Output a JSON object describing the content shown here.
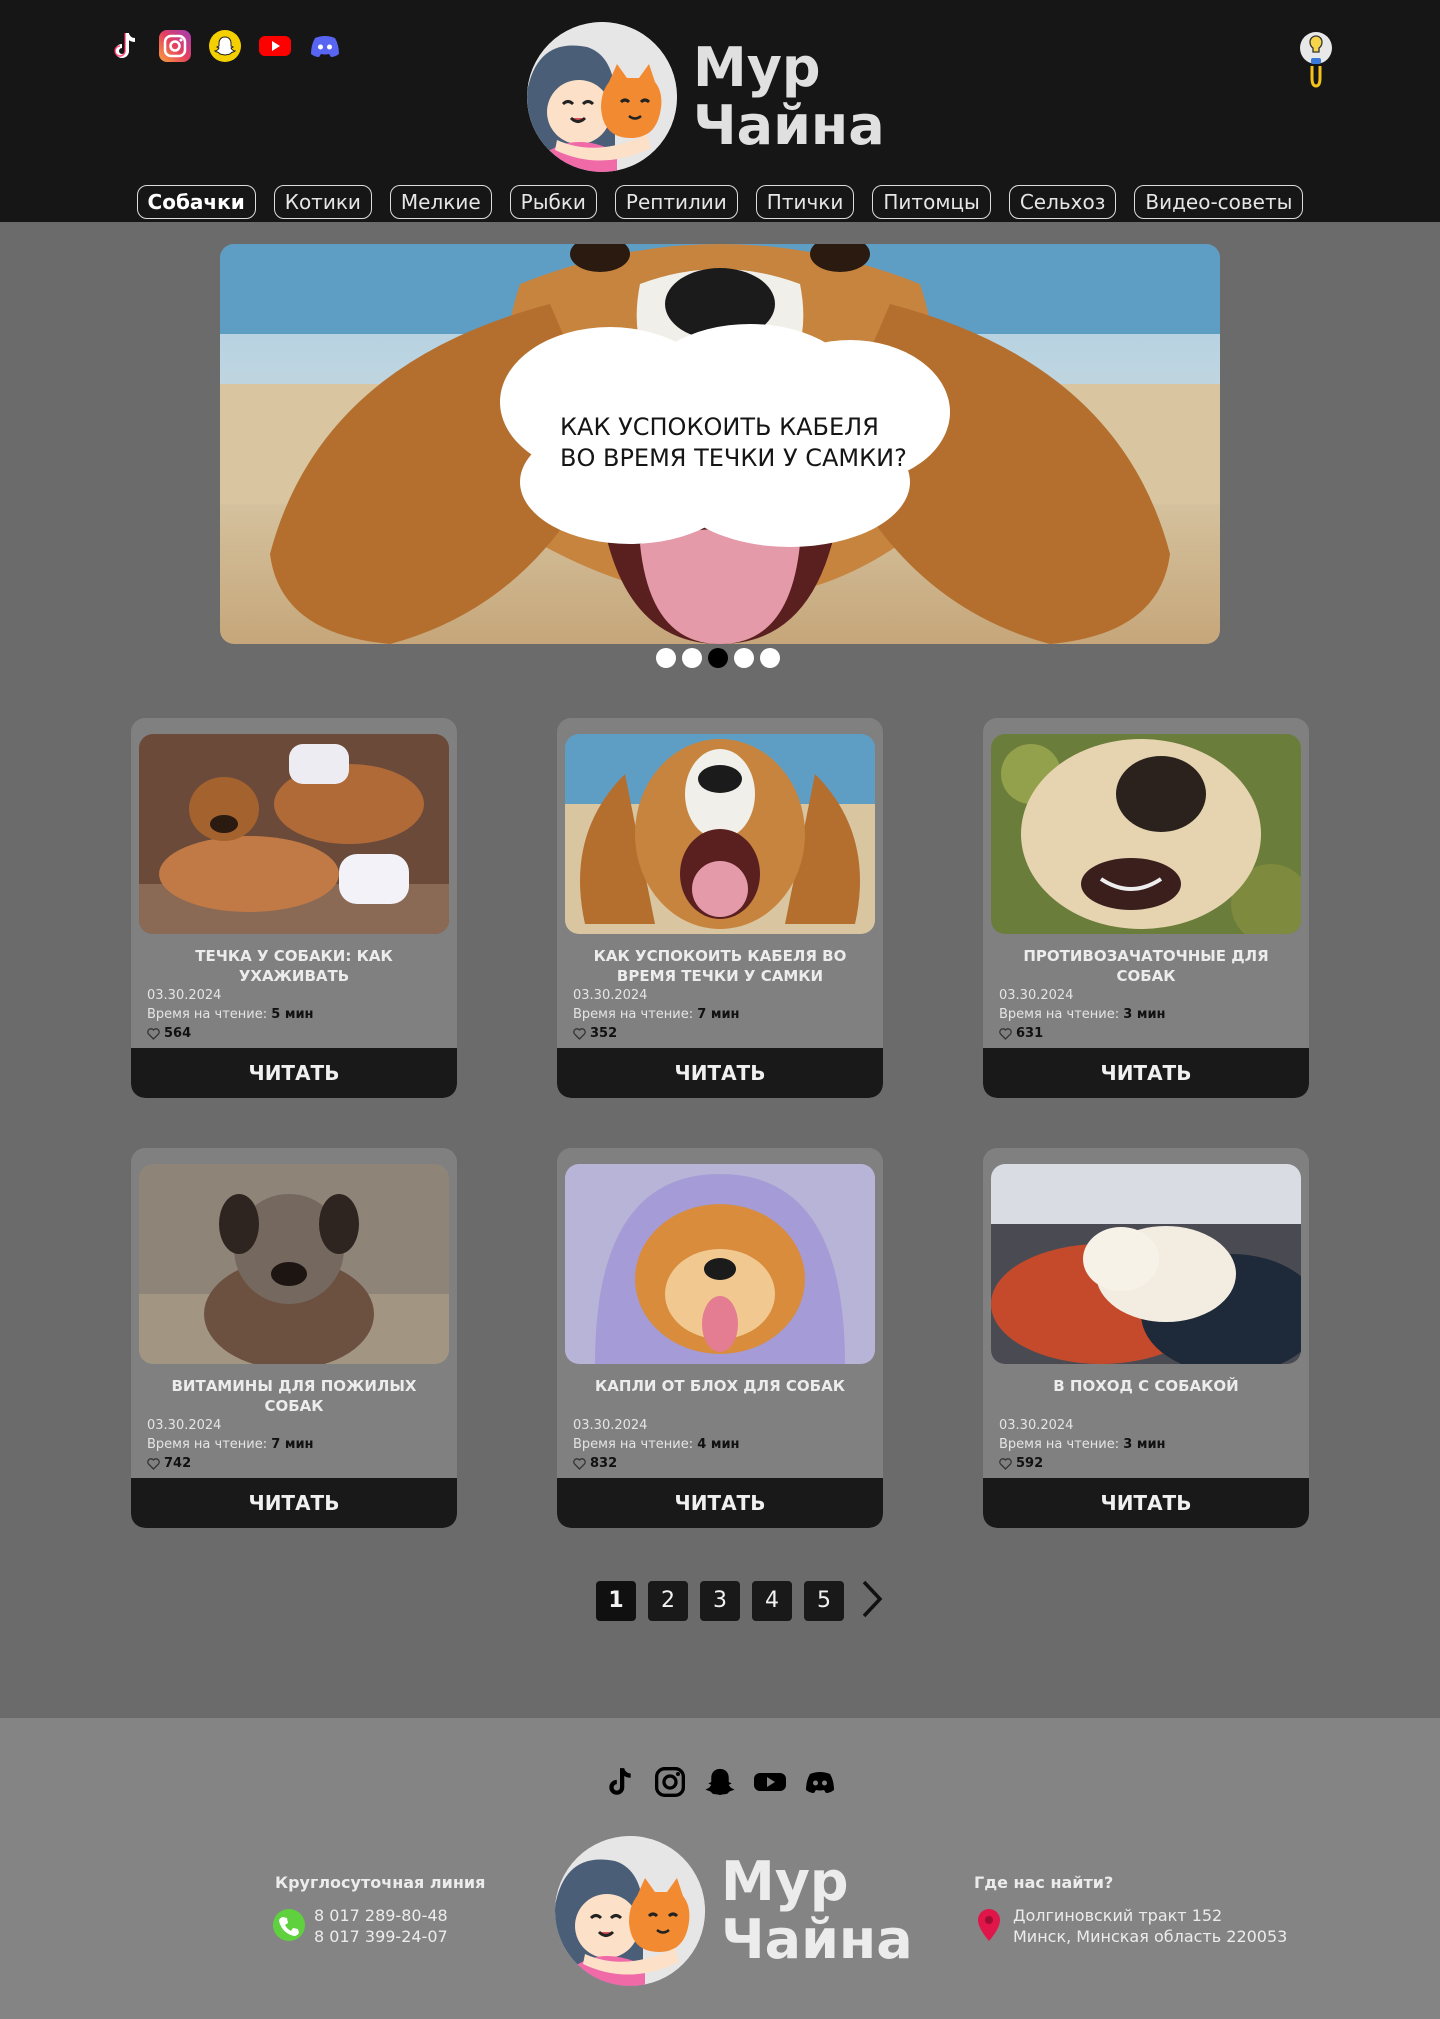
{
  "header": {
    "social": [
      "tiktok-icon",
      "instagram-icon",
      "snapchat-icon",
      "youtube-icon",
      "discord-icon"
    ],
    "logo_line1": "Мур",
    "logo_line2": "Чайна"
  },
  "nav": [
    {
      "label": "Собачки",
      "active": true
    },
    {
      "label": "Котики"
    },
    {
      "label": "Мелкие"
    },
    {
      "label": "Рыбки"
    },
    {
      "label": "Рептилии"
    },
    {
      "label": "Птички"
    },
    {
      "label": "Питомцы"
    },
    {
      "label": "Сельхоз"
    },
    {
      "label": "Видео-советы"
    }
  ],
  "hero": {
    "line1": "КАК УСПОКОИТЬ КАБЕЛЯ",
    "line2": "ВО ВРЕМЯ ТЕЧКИ У САМКИ?",
    "active_dot": 3,
    "dot_count": 5
  },
  "cards": [
    {
      "title": "ТЕЧКА У СОБАКИ: КАК УХАЖИВАТЬ",
      "date": "03.30.2024",
      "read_label": "Время на чтение: ",
      "read_time": "5 мин",
      "likes": "564",
      "button": "ЧИТАТЬ"
    },
    {
      "title": "КАК УСПОКОИТЬ КАБЕЛЯ ВО ВРЕМЯ ТЕЧКИ У САМКИ",
      "date": "03.30.2024",
      "read_label": "Время на чтение: ",
      "read_time": "7 мин",
      "likes": "352",
      "button": "ЧИТАТЬ"
    },
    {
      "title": "ПРОТИВОЗАЧАТОЧНЫЕ ДЛЯ СОБАК",
      "date": "03.30.2024",
      "read_label": "Время на чтение: ",
      "read_time": "3 мин",
      "likes": "631",
      "button": "ЧИТАТЬ"
    },
    {
      "title": "ВИТАМИНЫ ДЛЯ ПОЖИЛЫХ СОБАК",
      "date": "03.30.2024",
      "read_label": "Время на чтение: ",
      "read_time": "7 мин",
      "likes": "742",
      "button": "ЧИТАТЬ"
    },
    {
      "title": "КАПЛИ ОТ БЛОХ ДЛЯ СОБАК",
      "date": "03.30.2024",
      "read_label": "Время на чтение: ",
      "read_time": "4 мин",
      "likes": "832",
      "button": "ЧИТАТЬ"
    },
    {
      "title": "В ПОХОД С СОБАКОЙ",
      "date": "03.30.2024",
      "read_label": "Время на чтение: ",
      "read_time": "3 мин",
      "likes": "592",
      "button": "ЧИТАТЬ"
    }
  ],
  "pagination": {
    "pages": [
      "1",
      "2",
      "3",
      "4",
      "5"
    ],
    "active": "1",
    "next_icon": "chevron-right-icon"
  },
  "footer": {
    "hotline_title": "Круглосуточная линия",
    "phone1": "8 017 289-80-48",
    "phone2": "8 017 399-24-07",
    "location_title": "Где нас найти?",
    "address1": "Долгиновский тракт 152",
    "address2": "Минск, Минская область 220053",
    "logo_line1": "Мур",
    "logo_line2": "Чайна"
  }
}
